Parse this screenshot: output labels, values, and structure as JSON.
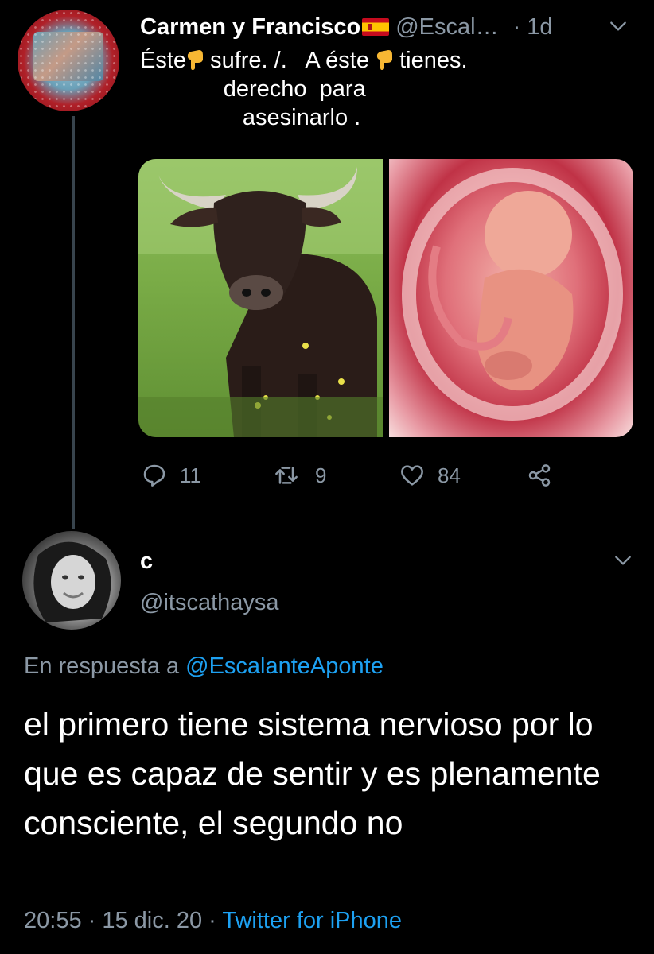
{
  "parent_tweet": {
    "display_name": "Carmen y Francisco",
    "handle": "@Escal…",
    "time": "· 1d",
    "text_line1_a": "Éste",
    "text_line1_b": " sufre. /.   A éste ",
    "text_line1_c": " tienes.",
    "text_line2": "             derecho  para",
    "text_line3": "                asesinarlo .",
    "actions": {
      "replies": "11",
      "retweets": "9",
      "likes": "84"
    }
  },
  "reply_tweet": {
    "display_name": "c",
    "handle": "@itscathaysa",
    "in_reply_prefix": "En respuesta a",
    "in_reply_handle": "@EscalanteAponte",
    "body": "el primero tiene sistema nervioso por lo que es capaz de sentir y es plenamente consciente, el segundo no",
    "time": "20:55 · 15 dic. 20 ·",
    "source": "Twitter for iPhone"
  },
  "colors": {
    "background": "#000000",
    "text": "#ffffff",
    "secondary": "#8b98a5",
    "link": "#1da1f2",
    "thread_line": "#38444d"
  },
  "icons": [
    "reply-icon",
    "retweet-icon",
    "like-icon",
    "share-icon",
    "chevron-down-icon",
    "pointing-down-icon",
    "spain-flag-icon"
  ]
}
